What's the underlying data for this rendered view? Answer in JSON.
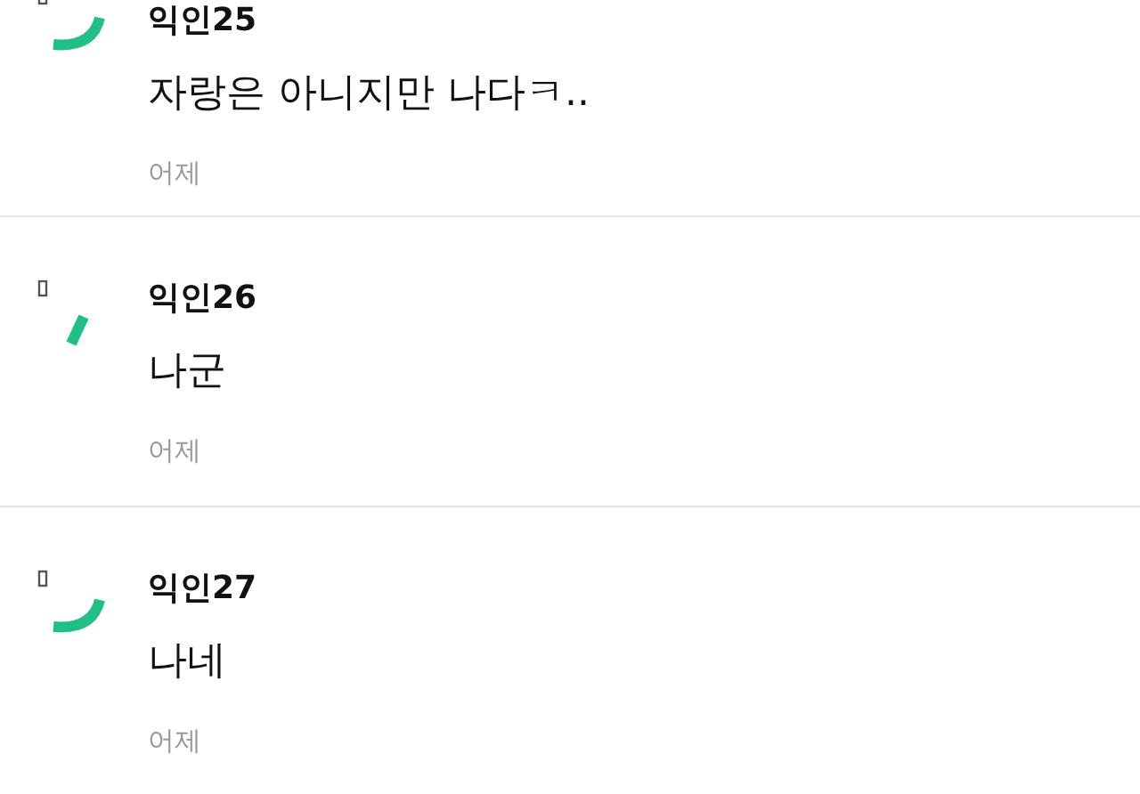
{
  "comments": [
    {
      "avatar": {
        "kind": "arc"
      },
      "name": "익인25",
      "text": "자랑은 아니지만 나다ㅋ..",
      "time": "어제"
    },
    {
      "avatar": {
        "kind": "slash"
      },
      "name": "익인26",
      "text": "나군",
      "time": "어제"
    },
    {
      "avatar": {
        "kind": "arc"
      },
      "name": "익인27",
      "text": "나네",
      "time": "어제"
    }
  ]
}
